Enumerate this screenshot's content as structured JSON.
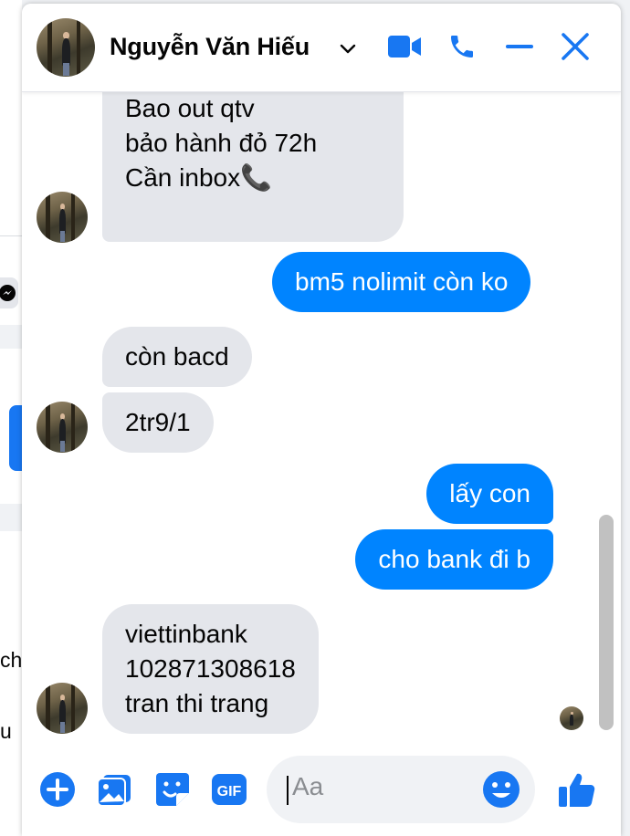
{
  "background": {
    "text_fragments": [
      "ch",
      "u"
    ]
  },
  "header": {
    "contact_name": "Nguyễn Văn Hiếu",
    "icons": [
      "chevron-down-icon",
      "video-call-icon",
      "phone-icon",
      "minimize-icon",
      "close-icon"
    ]
  },
  "messages": [
    {
      "direction": "in",
      "text": "Bao out qtv\nbảo hành đỏ 72h\nCần inbox📞"
    },
    {
      "direction": "out",
      "text": "bm5 nolimit còn ko"
    },
    {
      "direction": "in",
      "text": "còn bacd"
    },
    {
      "direction": "in",
      "text": "2tr9/1"
    },
    {
      "direction": "out",
      "text": "lấy con"
    },
    {
      "direction": "out",
      "text": "cho bank đi b"
    },
    {
      "direction": "in",
      "text": "viettinbank\n102871308618\ntran thi trang"
    }
  ],
  "composer": {
    "placeholder": "Aa",
    "icons": [
      "plus-icon",
      "photo-icon",
      "sticker-icon",
      "gif-icon",
      "emoji-icon",
      "thumbs-up-icon"
    ],
    "gif_label": "GIF"
  },
  "colors": {
    "accent": "#0084ff",
    "incoming_bubble": "#e4e6eb",
    "icon_blue": "#1877f2"
  }
}
